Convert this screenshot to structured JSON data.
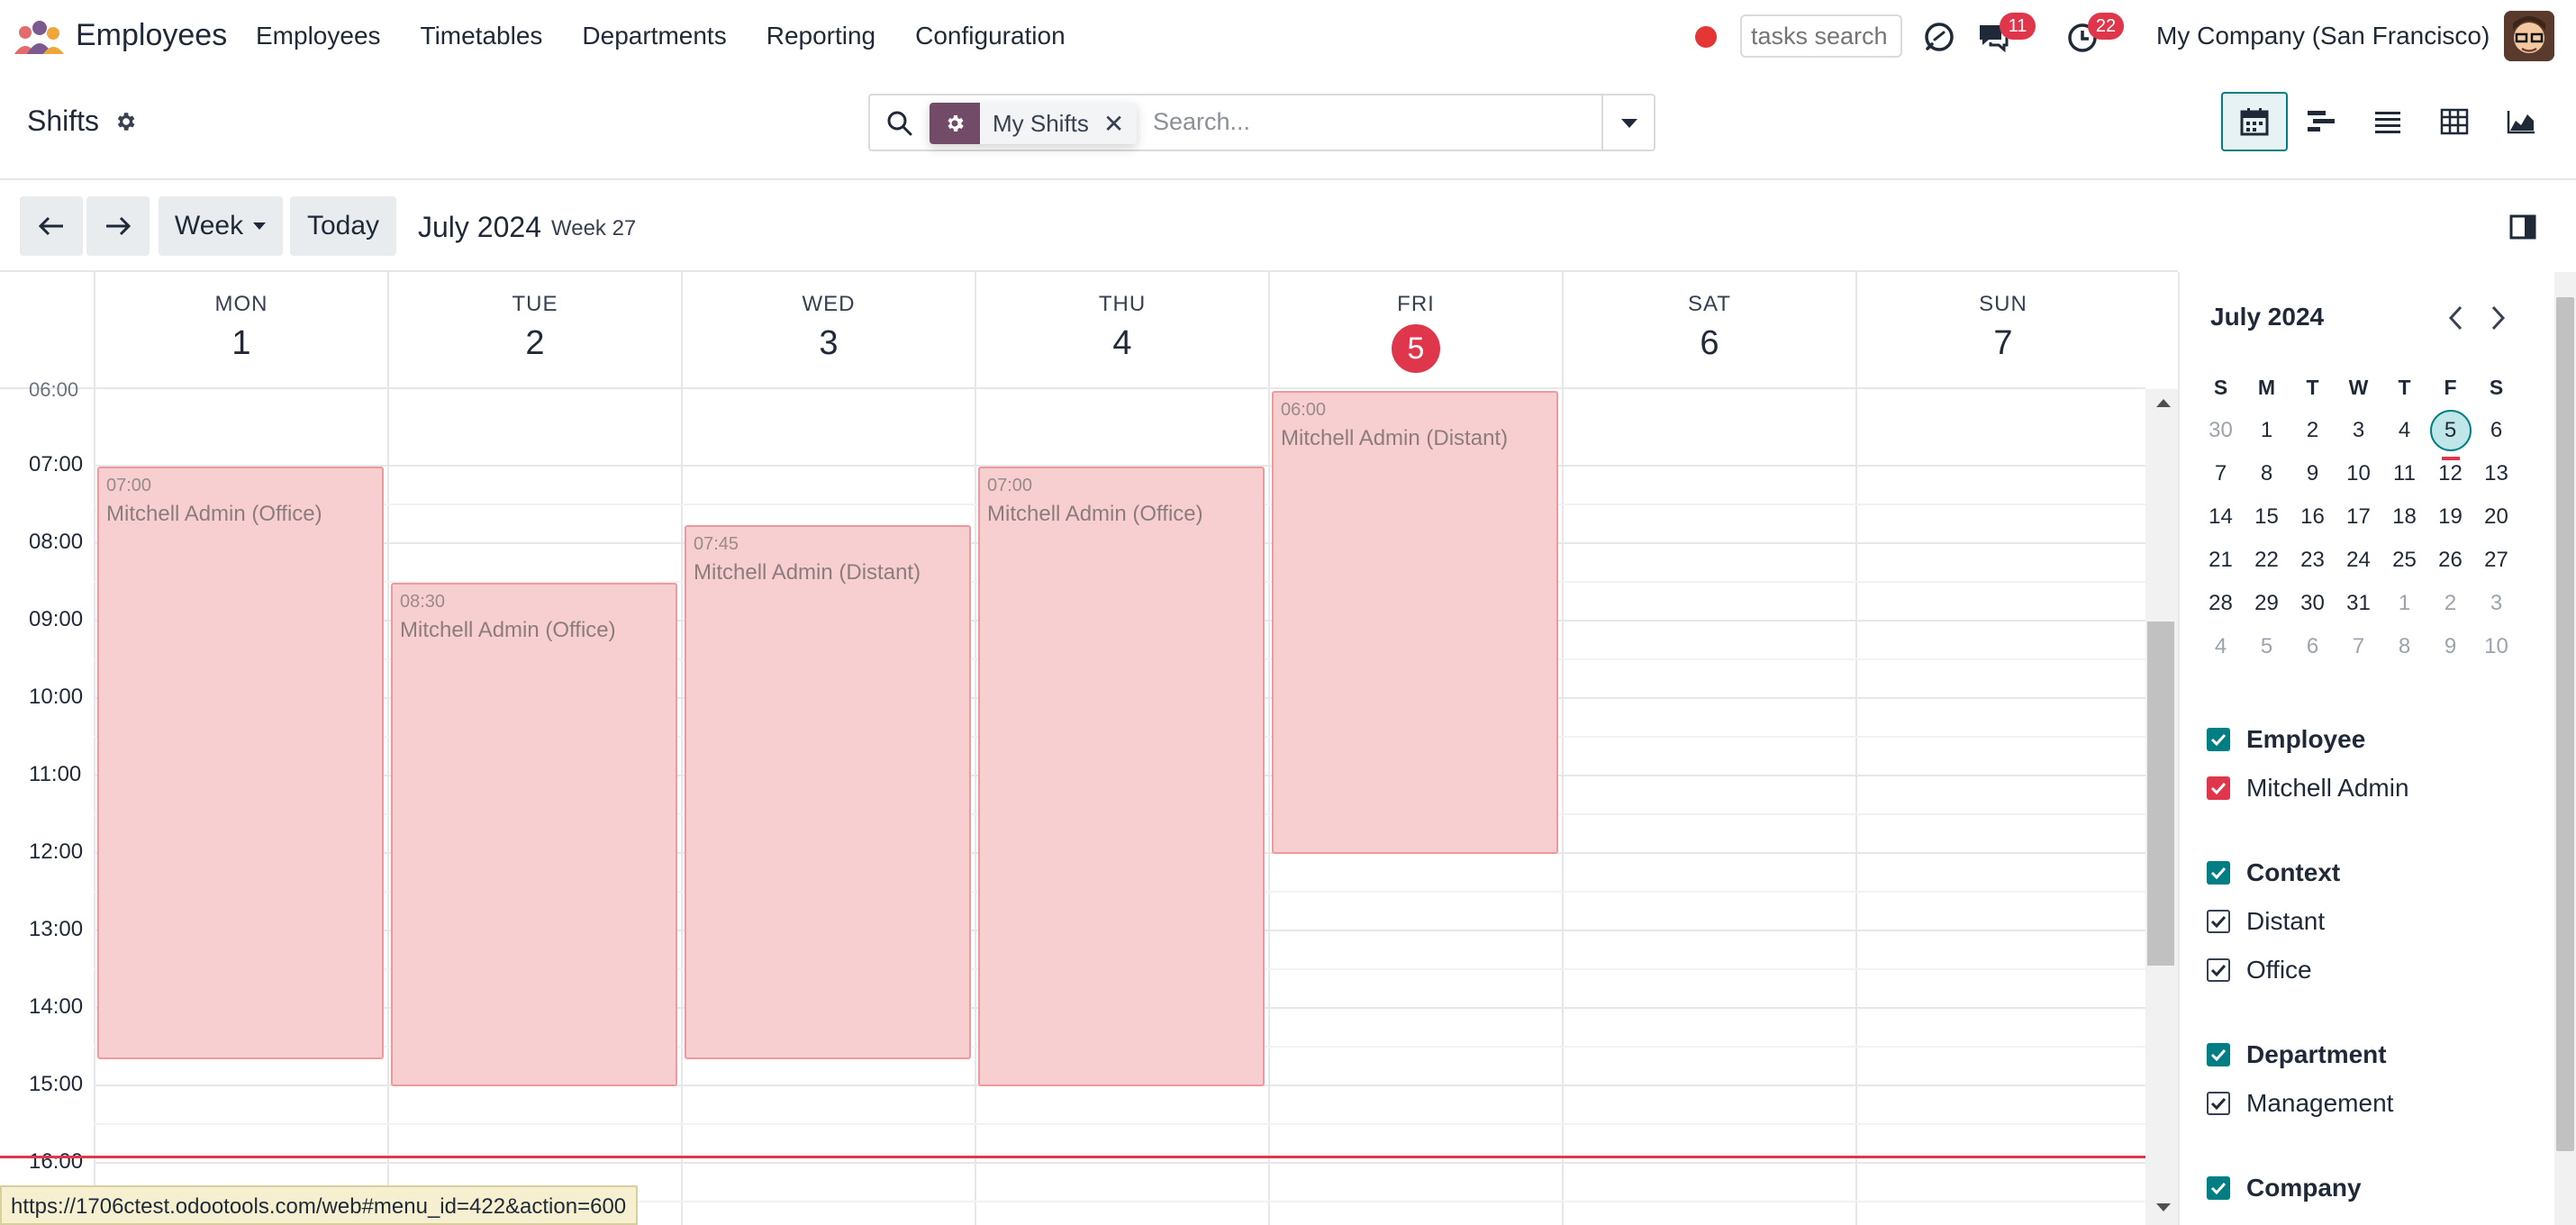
{
  "app": {
    "title": "Employees"
  },
  "menu": [
    "Employees",
    "Timetables",
    "Departments",
    "Reporting",
    "Configuration"
  ],
  "systray": {
    "tasks_search_placeholder": "tasks search",
    "messages_count": "11",
    "activities_count": "22",
    "company": "My Company (San Francisco)"
  },
  "control_panel": {
    "title": "Shifts",
    "facet_label": "My Shifts",
    "search_placeholder": "Search..."
  },
  "toolbar": {
    "scale": "Week",
    "today": "Today",
    "period_title": "July 2024",
    "week": "Week 27"
  },
  "days": [
    {
      "name": "MON",
      "num": "1"
    },
    {
      "name": "TUE",
      "num": "2"
    },
    {
      "name": "WED",
      "num": "3"
    },
    {
      "name": "THU",
      "num": "4"
    },
    {
      "name": "FRI",
      "num": "5",
      "today": true
    },
    {
      "name": "SAT",
      "num": "6"
    },
    {
      "name": "SUN",
      "num": "7"
    }
  ],
  "hours": [
    "07:00",
    "08:00",
    "09:00",
    "10:00",
    "11:00",
    "12:00",
    "13:00",
    "14:00",
    "15:00",
    "16:00"
  ],
  "events": [
    {
      "day": 0,
      "time": "07:00",
      "title": "Mitchell Admin (Office)"
    },
    {
      "day": 1,
      "time": "08:30",
      "title": "Mitchell Admin (Office)"
    },
    {
      "day": 2,
      "time": "07:45",
      "title": "Mitchell Admin (Distant)"
    },
    {
      "day": 3,
      "time": "07:00",
      "title": "Mitchell Admin (Office)"
    },
    {
      "day": 4,
      "time": "06:00",
      "title": "Mitchell Admin (Distant)"
    }
  ],
  "mini_calendar": {
    "title": "July 2024",
    "weekdays": [
      "S",
      "M",
      "T",
      "W",
      "T",
      "F",
      "S"
    ],
    "weeks": [
      [
        "30",
        "1",
        "2",
        "3",
        "4",
        "5",
        "6"
      ],
      [
        "7",
        "8",
        "9",
        "10",
        "11",
        "12",
        "13"
      ],
      [
        "14",
        "15",
        "16",
        "17",
        "18",
        "19",
        "20"
      ],
      [
        "21",
        "22",
        "23",
        "24",
        "25",
        "26",
        "27"
      ],
      [
        "28",
        "29",
        "30",
        "31",
        "1",
        "2",
        "3"
      ],
      [
        "4",
        "5",
        "6",
        "7",
        "8",
        "9",
        "10"
      ]
    ],
    "selected": "5"
  },
  "filters": {
    "employee": {
      "title": "Employee",
      "items": [
        "Mitchell Admin"
      ]
    },
    "context": {
      "title": "Context",
      "items": [
        "Distant",
        "Office"
      ]
    },
    "department": {
      "title": "Department",
      "items": [
        "Management"
      ]
    },
    "company": {
      "title": "Company"
    }
  },
  "status_url": "https://1706ctest.odootools.com/web#menu_id=422&action=600",
  "colors": {
    "brand": "#714b67",
    "accent": "#017e84",
    "today": "#e0364b",
    "event_bg": "#f8cfd0",
    "event_border": "#ee9a9c"
  }
}
